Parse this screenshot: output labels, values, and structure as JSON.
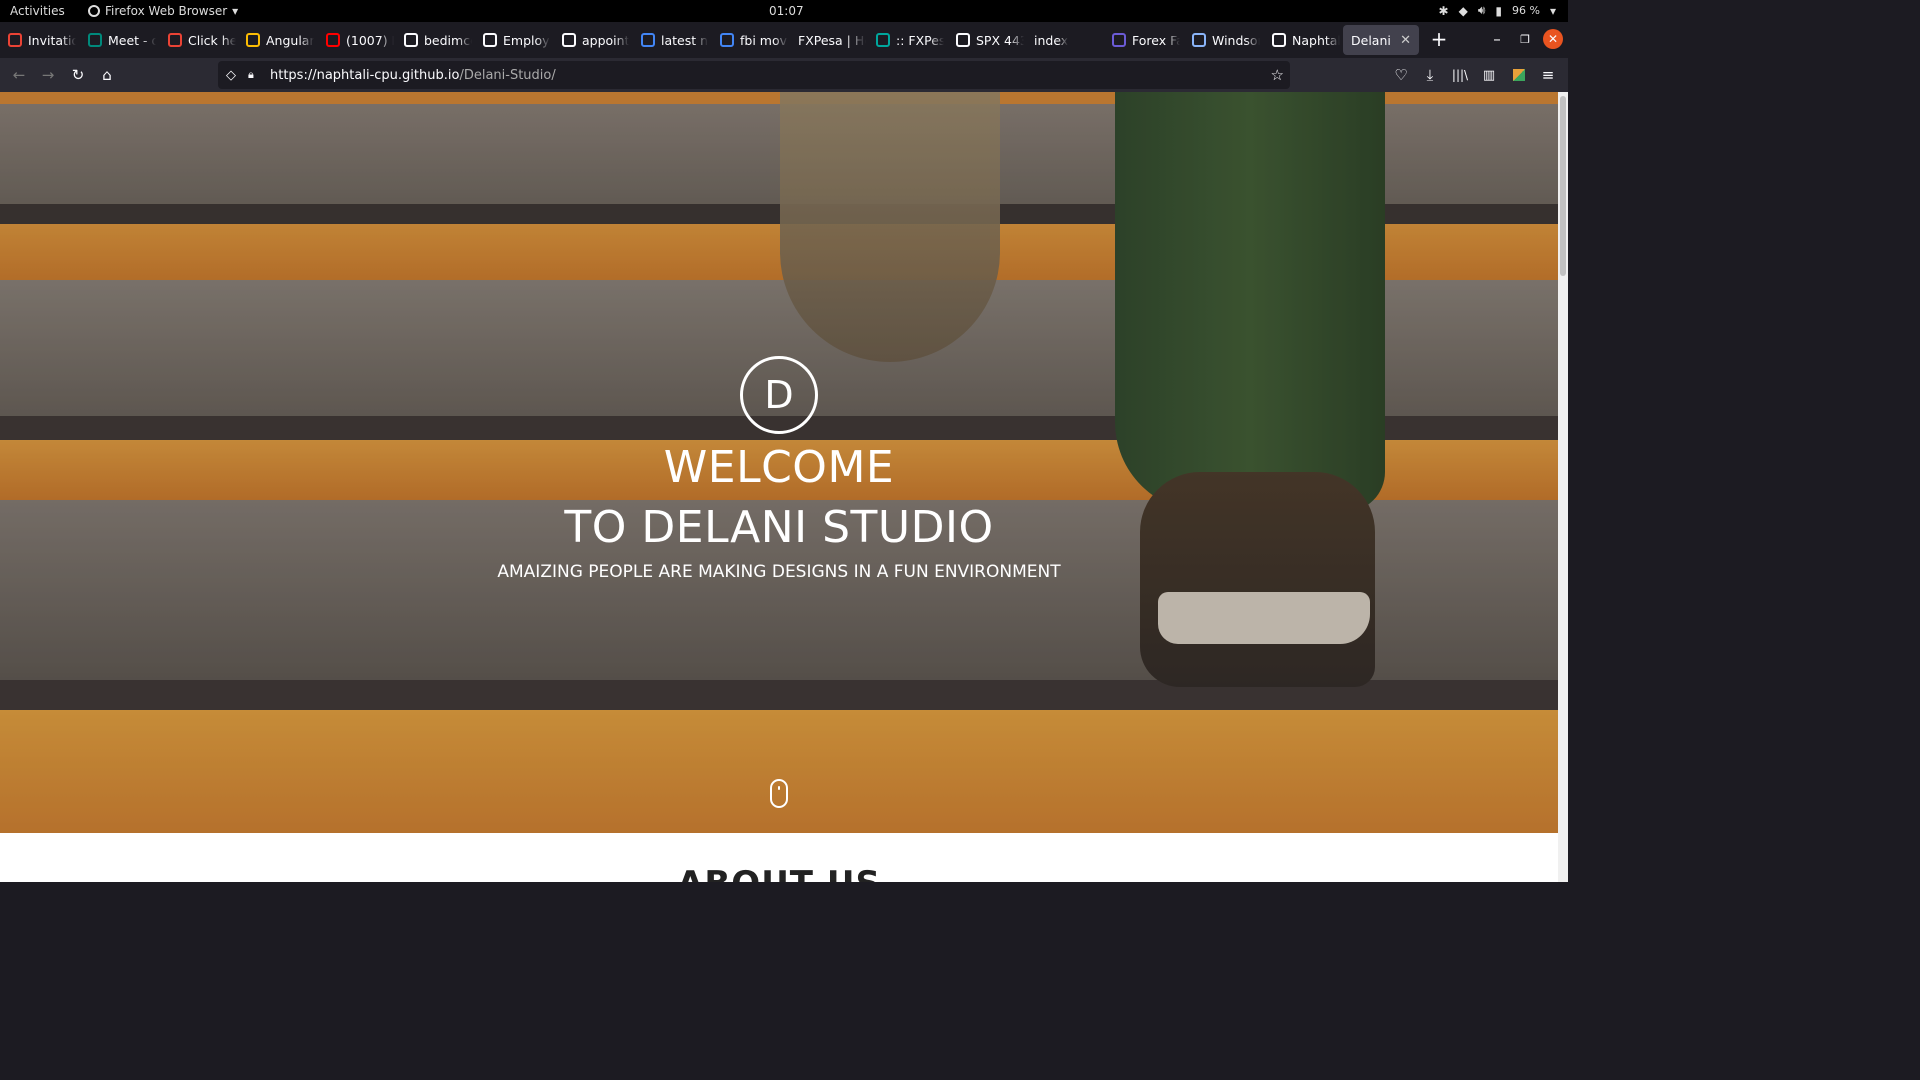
{
  "system": {
    "activities": "Activities",
    "app_name": "Firefox Web Browser",
    "clock": "01:07",
    "battery": "96 %"
  },
  "tabs": [
    {
      "label": "Invitatio",
      "favicon": "gmail-icon",
      "color": "#ea4335"
    },
    {
      "label": "Meet - q",
      "favicon": "meet-icon",
      "color": "#00897b"
    },
    {
      "label": "Click he",
      "favicon": "gmail-icon",
      "color": "#ea4335"
    },
    {
      "label": "Angular",
      "favicon": "drive-icon",
      "color": "#fbbc04"
    },
    {
      "label": "(1007) F",
      "favicon": "youtube-icon",
      "color": "#ff0000"
    },
    {
      "label": "bedimcc",
      "favicon": "github-icon",
      "color": "#fbfbfe"
    },
    {
      "label": "Employ",
      "favicon": "github-icon",
      "color": "#fbfbfe"
    },
    {
      "label": "appoint",
      "favicon": "github-icon",
      "color": "#fbfbfe"
    },
    {
      "label": "latest n",
      "favicon": "google-icon",
      "color": "#4285f4"
    },
    {
      "label": "fbi movi",
      "favicon": "google-icon",
      "color": "#4285f4"
    },
    {
      "label": "FXPesa | He",
      "favicon": "",
      "color": ""
    },
    {
      "label": ":: FXPes",
      "favicon": "fxpesa-icon",
      "color": "#00a69c"
    },
    {
      "label": "SPX 443",
      "favicon": "tradingview-icon",
      "color": "#fbfbfe"
    },
    {
      "label": "index",
      "favicon": "",
      "color": ""
    },
    {
      "label": "Forex Fa",
      "favicon": "forex-icon",
      "color": "#6b5bd6"
    },
    {
      "label": "Windsor",
      "favicon": "windsor-icon",
      "color": "#8ab4f8"
    },
    {
      "label": "Naphtal",
      "favicon": "github-icon",
      "color": "#fbfbfe"
    },
    {
      "label": "Delani",
      "favicon": "",
      "color": "",
      "active": true
    }
  ],
  "url": {
    "host": "https://naphtali-cpu.github.io",
    "path": "/Delani-Studio/"
  },
  "hero": {
    "logo_letter": "D",
    "title_line1": "WELCOME",
    "title_line2": "TO DELANI STUDIO",
    "subtitle": "AMAIZING PEOPLE ARE MAKING DESIGNS IN A FUN ENVIRONMENT"
  },
  "next_section": {
    "title": "ABOUT US"
  },
  "colors": {
    "accent_orange": "#e8a13a",
    "close_button": "#e95420"
  }
}
